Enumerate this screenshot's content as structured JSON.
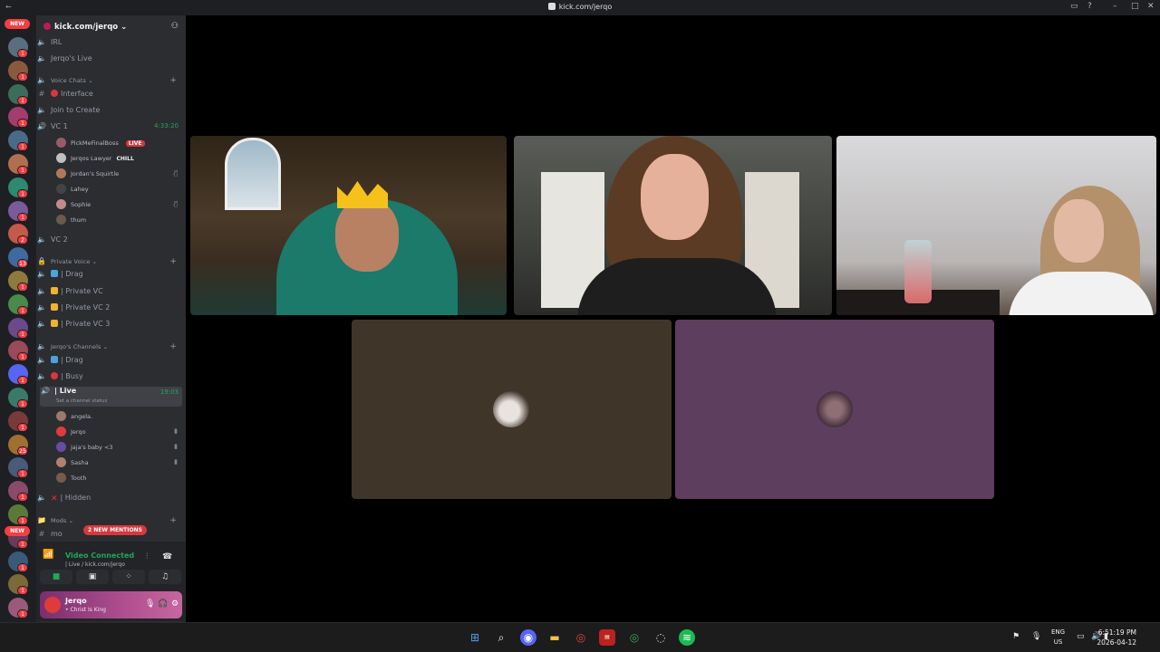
{
  "titlebar": {
    "title": "kick.com/jerqo",
    "back_icon": "back-arrow-icon"
  },
  "guilds": {
    "new_top": "NEW",
    "new_bottom": "NEW",
    "badges": [
      "1",
      "1",
      "1",
      "1",
      "1",
      "1",
      "1",
      "1",
      "2",
      "13",
      "1",
      "1",
      "1",
      "1",
      "1",
      "1",
      "1",
      "25",
      "1",
      "1",
      "1",
      "1",
      "1",
      "1",
      "1"
    ]
  },
  "server": {
    "name": "kick.com/jerqo"
  },
  "channels": {
    "irl": "IRL",
    "jerqos_live": "Jerqo's Live",
    "cat_voice_chats": "Voice Chats",
    "interface": "Interface",
    "join_to_create": "Join to Create",
    "vc1": "VC 1",
    "vc1_time": "4:33:20",
    "vc1_users": [
      {
        "name": "PickMeFinalBoss",
        "badge": "LIVE"
      },
      {
        "name": "Jerqos Lawyer",
        "badge": "CHILL"
      },
      {
        "name": "Jordan's Squirtle",
        "badge": ""
      },
      {
        "name": "Lahey",
        "badge": ""
      },
      {
        "name": "Sophie",
        "badge": ""
      },
      {
        "name": "thum",
        "badge": ""
      }
    ],
    "vc2": "VC 2",
    "cat_private_voice": "Private Voice",
    "drag1": "| Drag",
    "private_vc": "| Private VC",
    "private_vc2": "| Private VC 2",
    "private_vc3": "| Private VC 3",
    "cat_jerqos_channels": "Jerqo's Channels",
    "drag2": "| Drag",
    "busy": "| Busy",
    "live": "| Live",
    "live_time": "19:03",
    "live_status": "Set a channel status",
    "live_users": [
      "angela.",
      "Jerqo",
      "jaja's baby <3",
      "Sasha",
      "Tooth"
    ],
    "hidden": "| Hidden",
    "cat_mods": "Mods",
    "mod_partial": "mo",
    "new_mentions": "2 NEW MENTIONS"
  },
  "voice_panel": {
    "status": "Video Connected",
    "sub": "| Live / kick.com/jerqo"
  },
  "user_panel": {
    "name": "Jerqo",
    "status": "• Christ Is King"
  },
  "taskbar": {
    "lang_top": "ENG",
    "lang_bottom": "US",
    "time": "6:51:19 PM",
    "date": "2026-04-12"
  }
}
